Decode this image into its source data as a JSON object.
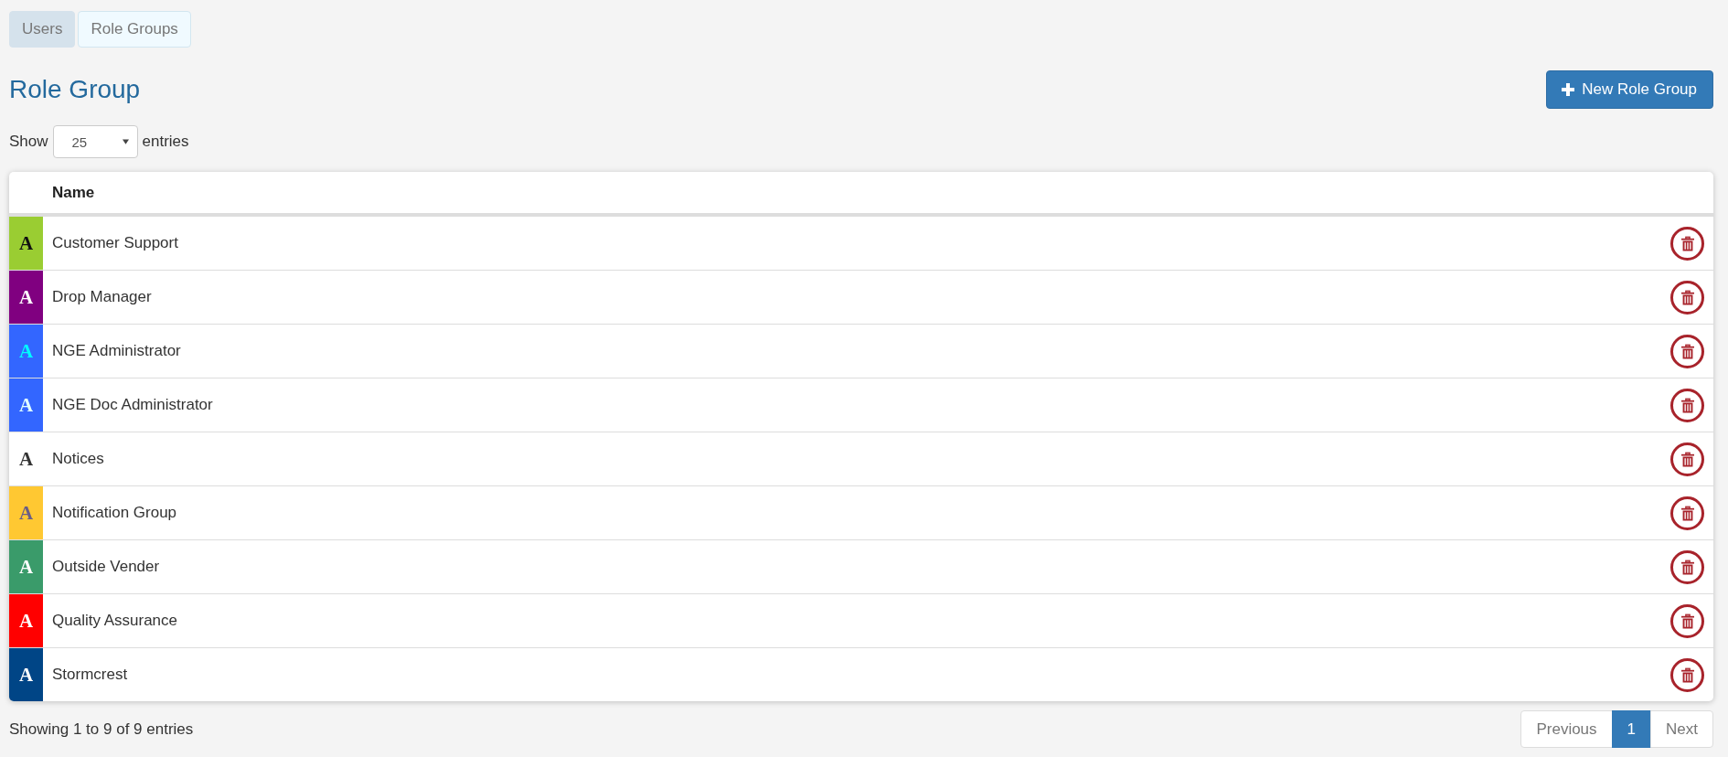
{
  "tabs": [
    {
      "label": "Users",
      "selected": false
    },
    {
      "label": "Role Groups",
      "selected": true
    }
  ],
  "page": {
    "title": "Role Group",
    "new_button": "New Role Group"
  },
  "length_control": {
    "prefix": "Show",
    "value": "25",
    "suffix": "entries"
  },
  "table": {
    "columns": [
      "Name"
    ],
    "rows": [
      {
        "name": "Customer Support",
        "color": "#9acd32",
        "icon": {
          "glyph": "A",
          "color": "#111111"
        }
      },
      {
        "name": "Drop Manager",
        "color": "#800080",
        "icon": {
          "glyph": "A",
          "color": "#ffffff"
        }
      },
      {
        "name": "NGE Administrator",
        "color": "#3366ff",
        "icon": {
          "glyph": "A",
          "color": "#00ffff"
        }
      },
      {
        "name": "NGE Doc Administrator",
        "color": "#3366ff",
        "icon": {
          "glyph": "A",
          "color": "#e0ffff"
        }
      },
      {
        "name": "Notices",
        "color": "#ffffff",
        "icon": {
          "glyph": "A",
          "color": "#333333"
        }
      },
      {
        "name": "Notification Group",
        "color": "#ffc832",
        "icon": {
          "glyph": "A",
          "color": "#6a5d86"
        }
      },
      {
        "name": "Outside Vender",
        "color": "#3a9b6a",
        "icon": {
          "glyph": "A",
          "color": "#ffffff"
        }
      },
      {
        "name": "Quality Assurance",
        "color": "#ff0000",
        "icon": {
          "glyph": "A",
          "color": "#ffffff"
        }
      },
      {
        "name": "Stormcrest",
        "color": "#004586",
        "icon": {
          "glyph": "A",
          "color": "#ffffff"
        }
      }
    ]
  },
  "footer": {
    "info": "Showing 1 to 9 of 9 entries",
    "pagination": [
      {
        "label": "Previous",
        "selected": false,
        "disabled": true
      },
      {
        "label": "1",
        "selected": true,
        "disabled": false
      },
      {
        "label": "Next",
        "selected": false,
        "disabled": true
      }
    ]
  }
}
